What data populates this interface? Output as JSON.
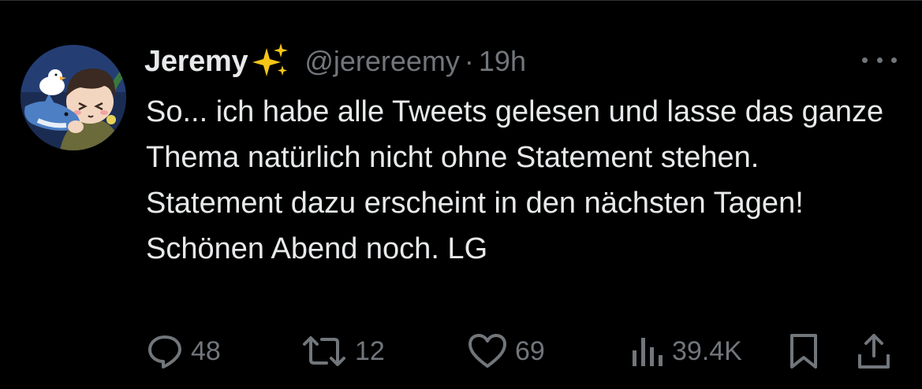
{
  "author": {
    "display_name": "Jeremy",
    "emoji_icon": "sparkles-icon",
    "handle": "@jerereemy",
    "separator": "·",
    "timestamp": "19h"
  },
  "tweet": {
    "paragraphs": [
      "So... ich habe alle Tweets gelesen und lasse das ganze Thema natürlich nicht ohne Statement stehen.",
      "Statement dazu erscheint in den nächsten Tagen! Schönen Abend noch. LG"
    ]
  },
  "actions": {
    "replies": "48",
    "retweets": "12",
    "likes": "69",
    "views": "39.4K"
  },
  "icons": {
    "more": "more-horizontal-icon",
    "reply": "reply-icon",
    "retweet": "retweet-icon",
    "like": "heart-icon",
    "views": "analytics-icon",
    "bookmark": "bookmark-icon",
    "share": "share-icon"
  },
  "colors": {
    "background": "#000000",
    "text": "#e7e9ea",
    "muted": "#71767b",
    "divider": "#2f3336"
  }
}
